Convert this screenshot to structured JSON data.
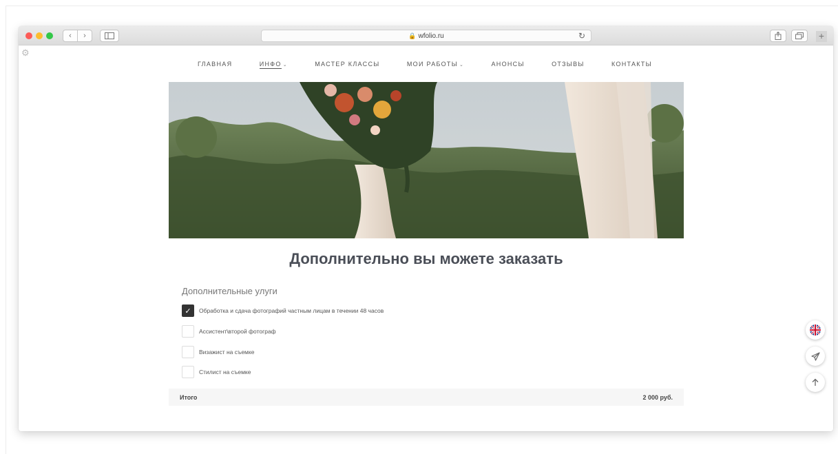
{
  "browser": {
    "url": "wfolio.ru",
    "back_icon": "chevron-left-icon",
    "forward_icon": "chevron-right-icon",
    "plus_label": "+"
  },
  "nav": {
    "items": [
      {
        "label": "ГЛАВНАЯ",
        "dropdown": false,
        "active": false
      },
      {
        "label": "ИНФО",
        "dropdown": true,
        "active": true
      },
      {
        "label": "МАСТЕР КЛАССЫ",
        "dropdown": false,
        "active": false
      },
      {
        "label": "МОИ РАБОТЫ",
        "dropdown": true,
        "active": false
      },
      {
        "label": "АНОНСЫ",
        "dropdown": false,
        "active": false
      },
      {
        "label": "ОТЗЫВЫ",
        "dropdown": false,
        "active": false
      },
      {
        "label": "КОНТАКТЫ",
        "dropdown": false,
        "active": false
      }
    ]
  },
  "main": {
    "title": "Дополнительно вы можете заказать",
    "services_heading": "Дополнительные улуги",
    "options": [
      {
        "label": "Обработка и сдача фотографий частным лицам в течении 48 часов",
        "checked": true
      },
      {
        "label": "Ассистент\\второй фотограф",
        "checked": false
      },
      {
        "label": "Визажист на съемке",
        "checked": false
      },
      {
        "label": "Стилист на съемке",
        "checked": false
      }
    ],
    "total_label": "Итого",
    "total_value": "2 000 руб."
  },
  "floating": {
    "language_icon": "uk-flag-icon",
    "share_icon": "send-icon",
    "top_icon": "arrow-up-icon"
  },
  "colors": {
    "accent_dark": "#333333",
    "title": "#4a4e57",
    "total_bg": "#f6f6f6"
  }
}
